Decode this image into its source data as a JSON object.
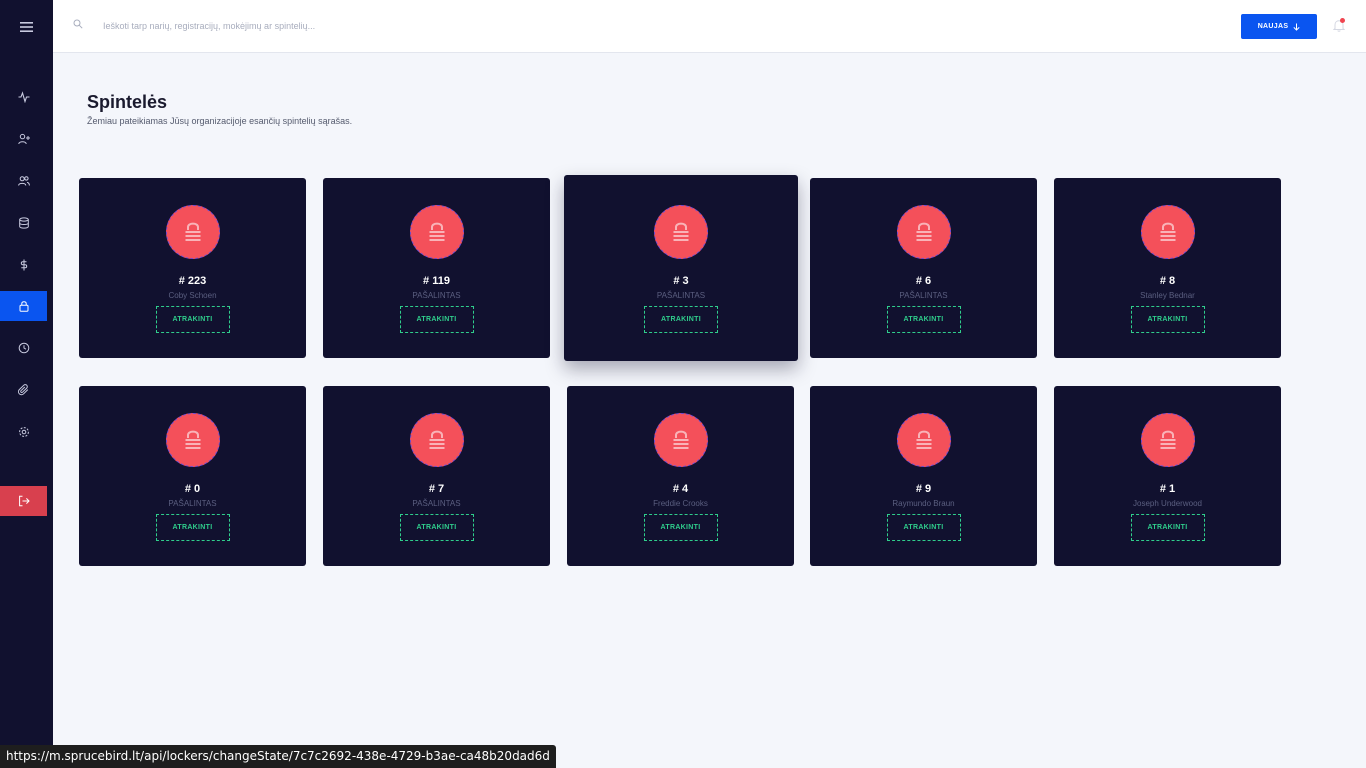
{
  "sidebar": {
    "items": [
      {
        "icon": "activity-icon"
      },
      {
        "icon": "user-plus-icon"
      },
      {
        "icon": "users-icon"
      },
      {
        "icon": "database-icon"
      },
      {
        "icon": "dollar-icon"
      },
      {
        "icon": "lock-icon",
        "active": true
      },
      {
        "icon": "clock-icon"
      },
      {
        "icon": "paperclip-icon"
      },
      {
        "icon": "settings-icon"
      },
      {
        "icon": "logout-icon"
      }
    ]
  },
  "topbar": {
    "search_placeholder": "Ieškoti tarp narių, registracijų, mokėjimų ar spintelių...",
    "new_button_label": "NAUJAS"
  },
  "page": {
    "title": "Spintelės",
    "subtitle": "Žemiau pateikiamas Jūsų organizacijoje esančių spintelių sąrašas."
  },
  "lockers": [
    {
      "number": "# 223",
      "subtitle": "Coby Schoen",
      "button": "ATRAKINTI"
    },
    {
      "number": "# 119",
      "subtitle": "PAŠALINTAS",
      "button": "ATRAKINTI"
    },
    {
      "number": "# 3",
      "subtitle": "PAŠALINTAS",
      "button": "ATRAKINTI"
    },
    {
      "number": "# 6",
      "subtitle": "PAŠALINTAS",
      "button": "ATRAKINTI"
    },
    {
      "number": "# 8",
      "subtitle": "Stanley Bednar",
      "button": "ATRAKINTI"
    },
    {
      "number": "# 0",
      "subtitle": "PAŠALINTAS",
      "button": "ATRAKINTI"
    },
    {
      "number": "# 7",
      "subtitle": "PAŠALINTAS",
      "button": "ATRAKINTI"
    },
    {
      "number": "# 4",
      "subtitle": "Freddie Crooks",
      "button": "ATRAKINTI"
    },
    {
      "number": "# 9",
      "subtitle": "Raymundo Braun",
      "button": "ATRAKINTI"
    },
    {
      "number": "# 1",
      "subtitle": "Joseph Underwood",
      "button": "ATRAKINTI"
    }
  ],
  "status_url": "https://m.sprucebird.lt/api/lockers/changeState/7c7c2692-438e-4729-b3ae-ca48b20dad6d",
  "colors": {
    "sidebar_bg": "#11112f",
    "accent": "#0a55f0",
    "danger": "#d8404e",
    "lock_circle": "#f4505a",
    "unlock_green": "#2fce8c"
  }
}
